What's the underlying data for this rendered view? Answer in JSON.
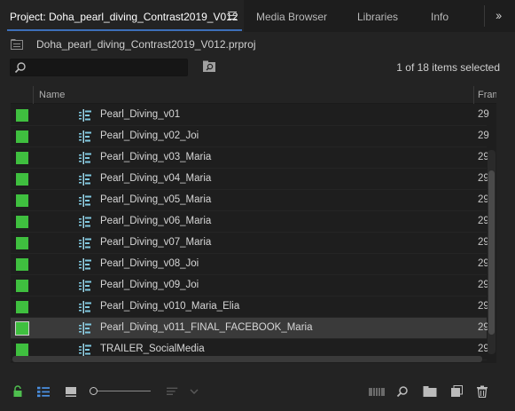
{
  "tabs": [
    {
      "label": "Project: Doha_pearl_diving_Contrast2019_V012",
      "active": true
    },
    {
      "label": "Media Browser",
      "active": false
    },
    {
      "label": "Libraries",
      "active": false
    },
    {
      "label": "Info",
      "active": false
    }
  ],
  "project": {
    "filename": "Doha_pearl_diving_Contrast2019_V012.prproj",
    "icon": "project-file-icon"
  },
  "search": {
    "value": "",
    "placeholder": "",
    "icon": "search-icon"
  },
  "selection_status": "1 of 18 items selected",
  "columns": {
    "name": "Name",
    "framerate": "Fram"
  },
  "label_color": "#3fbf3f",
  "rows": [
    {
      "name": "Pearl_Diving_v01",
      "framerate": "29",
      "selected": false
    },
    {
      "name": "Pearl_Diving_v02_Joi",
      "framerate": "29",
      "selected": false
    },
    {
      "name": "Pearl_Diving_v03_Maria",
      "framerate": "29",
      "selected": false
    },
    {
      "name": "Pearl_Diving_v04_Maria",
      "framerate": "29",
      "selected": false
    },
    {
      "name": "Pearl_Diving_v05_Maria",
      "framerate": "29",
      "selected": false
    },
    {
      "name": "Pearl_Diving_v06_Maria",
      "framerate": "29",
      "selected": false
    },
    {
      "name": "Pearl_Diving_v07_Maria",
      "framerate": "29",
      "selected": false
    },
    {
      "name": "Pearl_Diving_v08_Joi",
      "framerate": "29",
      "selected": false
    },
    {
      "name": "Pearl_Diving_v09_Joi",
      "framerate": "29",
      "selected": false
    },
    {
      "name": "Pearl_Diving_v010_Maria_Elia",
      "framerate": "29",
      "selected": false
    },
    {
      "name": "Pearl_Diving_v011_FINAL_FACEBOOK_Maria",
      "framerate": "29",
      "selected": true
    },
    {
      "name": "TRAILER_SocialMedia",
      "framerate": "29",
      "selected": false
    }
  ],
  "toolbar": {
    "icons": [
      "lock-icon",
      "list-view-icon",
      "icon-view-icon",
      "zoom-slider",
      "sort-icon",
      "automate-to-sequence-icon",
      "find-icon",
      "new-bin-icon",
      "new-item-icon",
      "clear-icon"
    ]
  }
}
